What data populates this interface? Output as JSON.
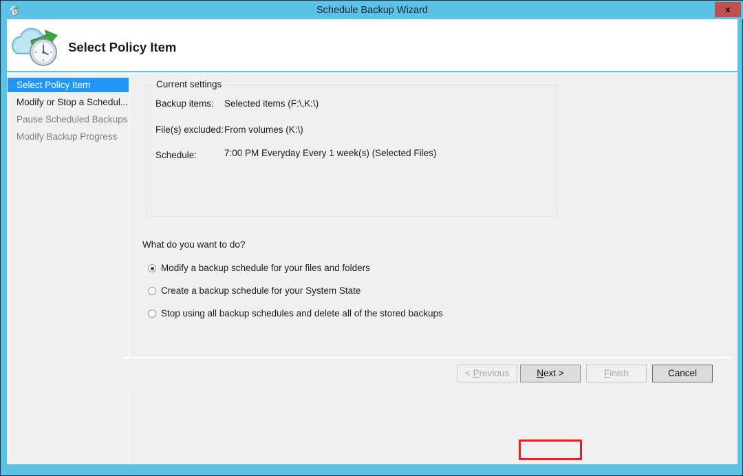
{
  "window": {
    "title": "Schedule Backup Wizard",
    "title_icon": "cloud-clock-icon",
    "close_label": "x",
    "accent_color": "#5bc2e7",
    "close_color": "#c0504d"
  },
  "header": {
    "title": "Select Policy Item",
    "icon": "cloud-backup-clock-icon"
  },
  "sidebar": {
    "items": [
      {
        "label": "Select Policy Item",
        "state": "active"
      },
      {
        "label": "Modify or Stop a Schedul...",
        "state": "enabled"
      },
      {
        "label": "Pause Scheduled Backups",
        "state": "disabled"
      },
      {
        "label": "Modify Backup Progress",
        "state": "disabled"
      }
    ],
    "active_color": "#2196f3"
  },
  "settings": {
    "legend": "Current settings",
    "rows": [
      {
        "label": "Backup items:",
        "value": "Selected items (F:\\,K:\\)"
      },
      {
        "label": "File(s) excluded:",
        "value": "From volumes (K:\\)"
      },
      {
        "label": "Schedule:",
        "value": "7:00 PM Everyday Every 1 week(s) (Selected Files)"
      }
    ]
  },
  "question": {
    "prompt": "What do you want to do?",
    "options": [
      {
        "label": "Modify a backup schedule for your files and folders",
        "selected": true
      },
      {
        "label": "Create a backup schedule for your System State",
        "selected": false
      },
      {
        "label": "Stop using all backup schedules and delete all of the stored backups",
        "selected": false
      }
    ]
  },
  "footer": {
    "buttons": [
      {
        "name": "previous",
        "prefix": "< ",
        "mnemonic": "P",
        "suffix": "revious",
        "enabled": false,
        "focused": false
      },
      {
        "name": "next",
        "prefix": "",
        "mnemonic": "N",
        "suffix": "ext >",
        "enabled": true,
        "focused": true
      },
      {
        "name": "finish",
        "prefix": "",
        "mnemonic": "F",
        "suffix": "inish",
        "enabled": false,
        "focused": false
      },
      {
        "name": "cancel",
        "prefix": "",
        "mnemonic": "",
        "suffix": "Cancel",
        "enabled": true,
        "focused": false
      }
    ],
    "highlight_color": "#ee1b24"
  }
}
